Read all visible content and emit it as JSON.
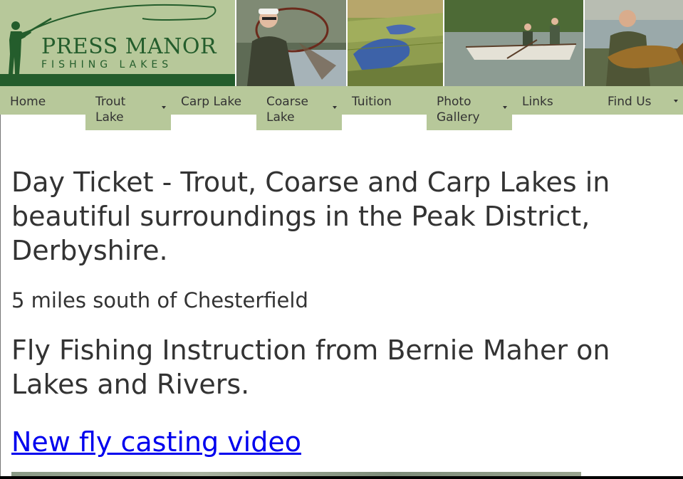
{
  "logo": {
    "title": "PRESS MANOR",
    "subtitle": "FISHING LAKES",
    "brand_color": "#245d2c",
    "background_color": "#b7c89a"
  },
  "header_photos": [
    {
      "subject": "angler-with-landing-net"
    },
    {
      "subject": "aerial-view-of-lakes"
    },
    {
      "subject": "anglers-in-boat"
    },
    {
      "subject": "angler-holding-carp"
    }
  ],
  "nav": {
    "background_color": "#b7c89a",
    "items": [
      {
        "label": "Home",
        "has_submenu": false
      },
      {
        "label": "Trout Lake",
        "has_submenu": true
      },
      {
        "label": "Carp Lake",
        "has_submenu": false
      },
      {
        "label": "Coarse Lake",
        "has_submenu": true
      },
      {
        "label": "Tuition",
        "has_submenu": false
      },
      {
        "label": "Photo Gallery",
        "has_submenu": true
      },
      {
        "label": "Links",
        "has_submenu": false
      },
      {
        "label": "Find Us",
        "has_submenu": true
      }
    ]
  },
  "main": {
    "headline": "Day Ticket - Trout, Coarse and Carp Lakes in beautiful surroundings in the Peak District, Derbyshire.",
    "location": "5 miles south of Chesterfield",
    "instruction": "Fly Fishing Instruction from Bernie Maher on Lakes and Rivers.",
    "video_link": "New fly casting video",
    "link_color": "#0000ee"
  }
}
